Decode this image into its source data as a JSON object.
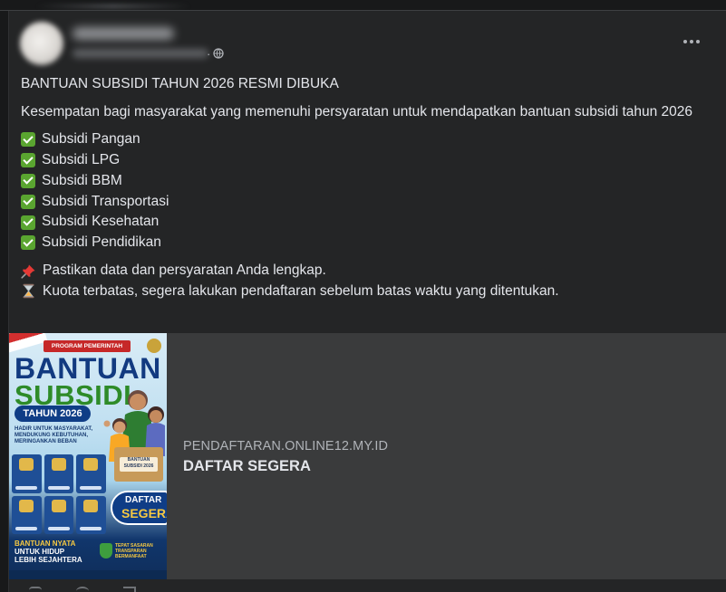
{
  "post": {
    "headline": "BANTUAN SUBSIDI TAHUN 2026 RESMI DIBUKA",
    "intro": "Kesempatan bagi masyarakat yang memenuhi persyaratan untuk mendapatkan bantuan subsidi tahun 2026",
    "checklist": [
      "Subsidi Pangan",
      "Subsidi LPG",
      "Subsidi BBM",
      "Subsidi Transportasi",
      "Subsidi Kesehatan",
      "Subsidi Pendidikan"
    ],
    "notes": [
      {
        "icon": "pushpin-icon",
        "text": "Pastikan data dan persyaratan Anda lengkap."
      },
      {
        "icon": "hourglass-icon",
        "text": "Kuota terbatas, segera lakukan pendaftaran sebelum batas waktu yang ditentukan."
      }
    ]
  },
  "link_preview": {
    "domain": "PENDAFTARAN.ONLINE12.MY.ID",
    "title": "DAFTAR SEGERA",
    "poster": {
      "program": "PROGRAM PEMERINTAH",
      "title_line1": "BANTUAN",
      "title_line2": "SUBSIDI",
      "year_badge": "TAHUN 2026",
      "tagline": "HADIR UNTUK MASYARAKAT, MENDUKUNG KEBUTUHAN, MERINGANKAN BEBAN",
      "box_label": "BANTUAN SUBSIDI 2026",
      "cta_line1": "DAFTAR",
      "cta_line2": "SEGERA",
      "bottom_left_1": "BANTUAN NYATA",
      "bottom_left_2": "UNTUK HIDUP",
      "bottom_left_3": "LEBIH SEJAHTERA",
      "bottom_right": "TEPAT SASARAN TRANSPARAN BERMANFAAT"
    }
  },
  "icons": {
    "globe": "globe-icon",
    "more": "more-options-icon",
    "check": "check-box-icon"
  },
  "colors": {
    "card_bg": "#242526",
    "page_bg": "#18191a",
    "preview_bg": "#3a3b3c",
    "text_primary": "#e4e6eb",
    "text_secondary": "#b0b3b8",
    "check_green": "#5aa530"
  }
}
